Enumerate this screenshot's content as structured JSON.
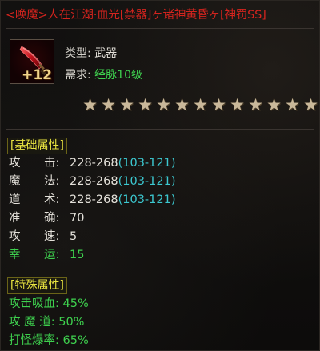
{
  "item": {
    "title": "<唤魔>人在江湖·血光[禁器]ヶ诸神黄昏ヶ[神罚SS]",
    "enhance": "+12",
    "icon": "red-blade-icon",
    "type_label": "类型:",
    "type_value": "武器",
    "req_label": "需求:",
    "req_value": "经脉10级",
    "star_count": 13,
    "star_glyph": "★"
  },
  "base_section": {
    "header": "[基础属性]",
    "stats": [
      {
        "l1": "攻",
        "l2": "击:",
        "value": "228-268",
        "bonus": "(103-121)",
        "color": "white"
      },
      {
        "l1": "魔",
        "l2": "法:",
        "value": "228-268",
        "bonus": "(103-121)",
        "color": "white"
      },
      {
        "l1": "道",
        "l2": "术:",
        "value": "228-268",
        "bonus": "(103-121)",
        "color": "white"
      },
      {
        "l1": "准",
        "l2": "确:",
        "value": "70",
        "bonus": "",
        "color": "white"
      },
      {
        "l1": "攻",
        "l2": "速:",
        "value": "5",
        "bonus": "",
        "color": "white"
      },
      {
        "l1": "幸",
        "l2": "运:",
        "value": "15",
        "bonus": "",
        "color": "green"
      }
    ]
  },
  "special_section": {
    "header": "[特殊属性]",
    "stats": [
      {
        "label": "攻击吸血:",
        "value": "45%"
      },
      {
        "label": "攻 魔 道:",
        "value": "50%"
      },
      {
        "label": "打怪爆率:",
        "value": "65%"
      }
    ]
  },
  "colors": {
    "title": "#d4241e",
    "section_header": "#e9e441",
    "white_value": "#e4e1da",
    "cyan_bonus": "#3cc8d0",
    "green": "#3ed04e",
    "star": "#c9b89a"
  }
}
